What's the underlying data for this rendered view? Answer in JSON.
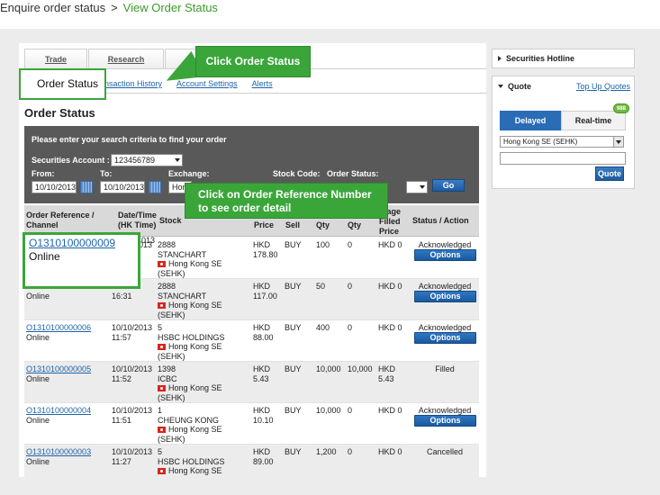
{
  "breadcrumb": {
    "first": "Enquire order status",
    "separator": ">",
    "current": "View Order Status"
  },
  "tabs": {
    "trade": "Trade",
    "research": "Research"
  },
  "subnav": {
    "history": "nsaction History",
    "account": "Account Settings",
    "alerts": "Alerts"
  },
  "page_title": "Order Status",
  "search": {
    "prompt": "Please enter your search criteria to find your order",
    "account_label": "Securities Account :",
    "account_value": "123456789",
    "from_label": "From:",
    "from_value": "10/10/2013",
    "to_label": "To:",
    "to_value": "10/10/2013",
    "exchange_label": "Exchange:",
    "exchange_value": "Hon",
    "stock_code_label": "Stock Code:",
    "order_status_label": "Order Status:",
    "go_label": "Go"
  },
  "table": {
    "headers": {
      "ref": [
        "Order Reference /",
        "Channel"
      ],
      "datetime": [
        "Date/Time",
        "(HK Time)"
      ],
      "stock": "Stock",
      "price": "Price",
      "side": "Sell",
      "qty": "Qty",
      "exec_qty": "Qty",
      "avg": [
        "erage",
        "Filled",
        "Price"
      ],
      "status": "Status / Action"
    },
    "rows": [
      {
        "ref": "O1310100000009",
        "channel": "Online",
        "date": "10/10/2013",
        "time": "",
        "code": "2888",
        "name": "STANCHART",
        "market1": "Hong Kong SE",
        "market2": "(SEHK)",
        "ccy": "HKD",
        "price": "178.80",
        "side": "BUY",
        "qty": "100",
        "exec": "0",
        "avg_ccy": "HKD 0",
        "avg_val": "",
        "status": "Acknowledged",
        "action": "Options"
      },
      {
        "ref": "",
        "channel": "Online",
        "date": "",
        "time": "16:31",
        "code": "2888",
        "name": "STANCHART",
        "market1": "Hong Kong SE",
        "market2": "(SEHK)",
        "ccy": "HKD",
        "price": "117.00",
        "side": "BUY",
        "qty": "50",
        "exec": "0",
        "avg_ccy": "HKD 0",
        "avg_val": "",
        "status": "Acknowledged",
        "action": "Options"
      },
      {
        "ref": "O1310100000006",
        "channel": "Online",
        "date": "10/10/2013",
        "time": "11:57",
        "code": "5",
        "name": "HSBC HOLDINGS",
        "market1": "Hong Kong SE",
        "market2": "(SEHK)",
        "ccy": "HKD",
        "price": "88.00",
        "side": "BUY",
        "qty": "400",
        "exec": "0",
        "avg_ccy": "HKD 0",
        "avg_val": "",
        "status": "Acknowledged",
        "action": "Options"
      },
      {
        "ref": "O1310100000005",
        "channel": "Online",
        "date": "10/10/2013",
        "time": "11:52",
        "code": "1398",
        "name": "ICBC",
        "market1": "Hong Kong SE",
        "market2": "(SEHK)",
        "ccy": "HKD",
        "price": "5.43",
        "side": "BUY",
        "qty": "10,000",
        "exec": "10,000",
        "avg_ccy": "HKD",
        "avg_val": "5.43",
        "status": "Filled",
        "action": ""
      },
      {
        "ref": "O1310100000004",
        "channel": "Online",
        "date": "10/10/2013",
        "time": "11:51",
        "code": "1",
        "name": "CHEUNG KONG",
        "market1": "Hong Kong SE",
        "market2": "(SEHK)",
        "ccy": "HKD",
        "price": "10.10",
        "side": "BUY",
        "qty": "10,000",
        "exec": "0",
        "avg_ccy": "HKD 0",
        "avg_val": "",
        "status": "Acknowledged",
        "action": "Options"
      },
      {
        "ref": "O1310100000003",
        "channel": "Online",
        "date": "10/10/2013",
        "time": "11:27",
        "code": "5",
        "name": "HSBC HOLDINGS",
        "market1": "Hong Kong SE",
        "market2": "",
        "ccy": "HKD",
        "price": "89.00",
        "side": "BUY",
        "qty": "1,200",
        "exec": "0",
        "avg_ccy": "HKD 0",
        "avg_val": "",
        "status": "Cancelled",
        "action": ""
      }
    ]
  },
  "date_partial": "013",
  "side": {
    "hotline": "Securities Hotline",
    "quote_title": "Quote",
    "topup": "Top Up Quotes",
    "delayed": "Delayed",
    "realtime": "Real-time",
    "badge": "988",
    "market": "Hong Kong SE (SEHK)",
    "quote_btn": "Quote"
  },
  "callouts": {
    "c1": "Click Order Status",
    "c2_line1": "Click on Order Reference Number",
    "c2_line2": "to see order detail",
    "box1": "Order Status",
    "box2_ref": "O1310100000009",
    "box2_channel": "Online"
  },
  "colors": {
    "accent_green": "#3aa63a",
    "link_blue": "#1d64a8",
    "button_blue": "#2a6cb5"
  }
}
